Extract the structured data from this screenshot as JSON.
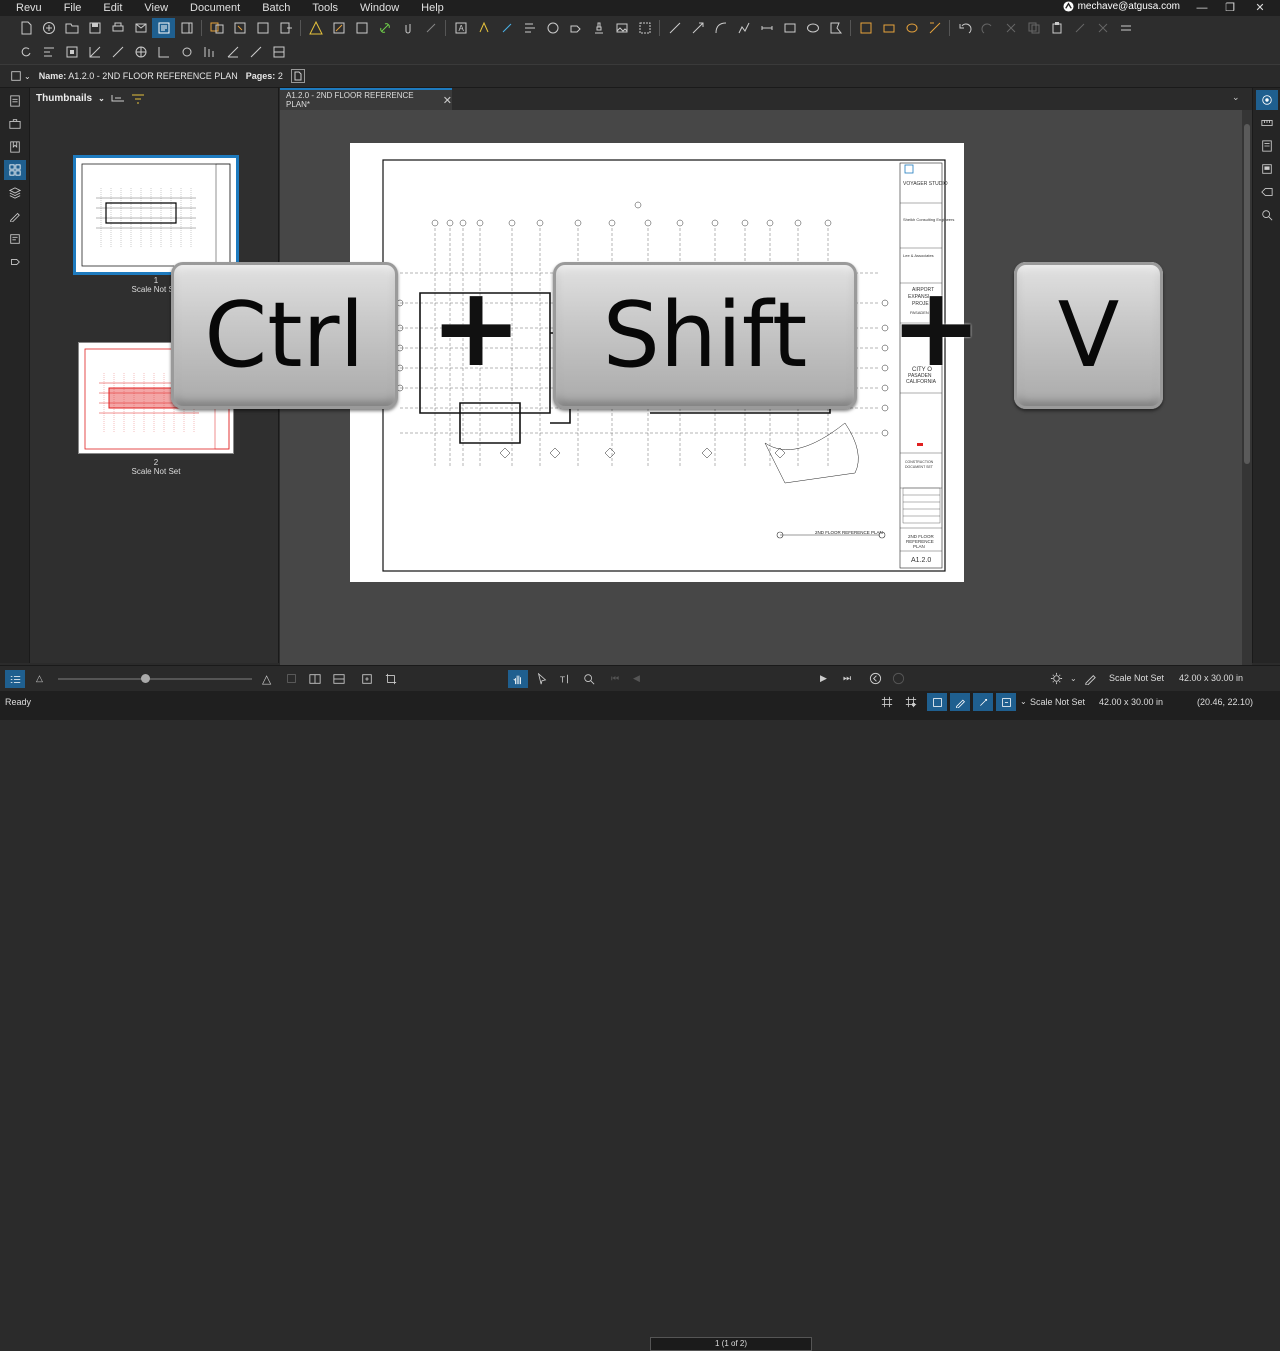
{
  "menu": [
    "Revu",
    "File",
    "Edit",
    "View",
    "Document",
    "Batch",
    "Tools",
    "Window",
    "Help"
  ],
  "user": "mechave@atgusa.com",
  "properties": {
    "name_label": "Name:",
    "name_value": "A1.2.0 - 2ND FLOOR REFERENCE PLAN",
    "pages_label": "Pages:",
    "pages_value": "2"
  },
  "thumbnails": {
    "title": "Thumbnails",
    "items": [
      {
        "number": "1",
        "scale": "Scale Not Set"
      },
      {
        "number": "2",
        "scale": "Scale Not Set"
      }
    ]
  },
  "doc_tab": {
    "label": "A1.2.0 - 2ND FLOOR REFERENCE PLAN*"
  },
  "titleblock": {
    "firm": "VOYAGER STUDIO",
    "consultant1": "Sheikh Consulting Engineers",
    "consultant2": "Lee & Associates",
    "project_lines": [
      "AIRPORT",
      "EXPANSI",
      "PROJE",
      "PASADEN"
    ],
    "city_lines": [
      "CITY O",
      "PASADEN",
      "CALIFORNIA"
    ],
    "stage_lines": [
      "CONSTRUCTION",
      "DOCUMENT SET"
    ],
    "sheet_title_lines": [
      "2ND FLOOR",
      "REFERENCE",
      "PLAN"
    ],
    "sheet_number": "A1.2.0",
    "drawing_caption": "2ND FLOOR REFERENCE PLAN"
  },
  "keys": {
    "k1": "Ctrl",
    "k2": "Shift",
    "k3": "V",
    "plus1": "+",
    "plus2": "+"
  },
  "navigation": {
    "page_indicator": "1 (1 of 2)"
  },
  "bottom_right": {
    "scale": "Scale Not Set",
    "size": "42.00 x 30.00 in"
  },
  "status": {
    "ready": "Ready",
    "scale": "Scale Not Set",
    "size": "42.00 x 30.00 in",
    "coords": "(20.46, 22.10)"
  },
  "colors": {
    "accent": "#1e7bbf",
    "markup_red": "#e02020"
  }
}
